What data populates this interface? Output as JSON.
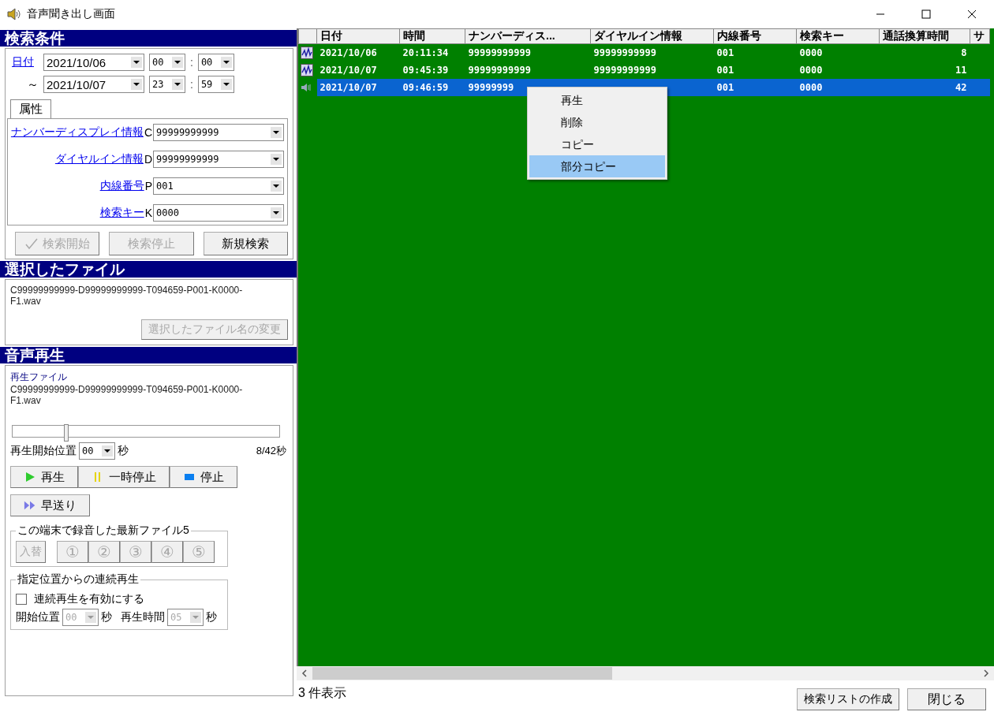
{
  "window": {
    "title": "音声聞き出し画面"
  },
  "search": {
    "title": "検索条件",
    "date_label": "日付",
    "range_mark": "～",
    "from": {
      "date": "2021/10/06",
      "hour": "00",
      "sep": ":",
      "minute": "00"
    },
    "to": {
      "date": "2021/10/07",
      "hour": "23",
      "sep": ":",
      "minute": "59"
    },
    "tabs": [
      {
        "label": "属性",
        "selected": true
      }
    ],
    "fields": [
      {
        "label": "ナンバーディスプレイ情報",
        "code": "C",
        "value": "99999999999"
      },
      {
        "label": "ダイヤルイン情報",
        "code": "D",
        "value": "99999999999"
      },
      {
        "label": "内線番号",
        "code": "P",
        "value": "001"
      },
      {
        "label": "検索キー",
        "code": "K",
        "value": "0000"
      }
    ],
    "buttons": [
      {
        "label": "検索開始",
        "kind": "check",
        "disabled": true
      },
      {
        "label": "検索停止",
        "kind": "plain",
        "disabled": true
      },
      {
        "label": "新規検索",
        "kind": "plain",
        "disabled": false
      }
    ]
  },
  "selected_file": {
    "title": "選択したファイル",
    "name": "C99999999999-D99999999999-T094659-P001-K0000-F1.wav",
    "rename_button": {
      "label": "選択したファイル名の変更",
      "disabled": true
    }
  },
  "playback": {
    "title": "音声再生",
    "file_label": "再生ファイル",
    "file_name": "C99999999999-D99999999999-T094659-P001-K0000-F1.wav",
    "level": 0.2,
    "start_label": "再生開始位置",
    "start_value": "00",
    "start_unit": "秒",
    "progress": "8/42秒",
    "buttons": [
      {
        "label": "再生",
        "kind": "play"
      },
      {
        "label": "一時停止",
        "kind": "pause"
      },
      {
        "label": "停止",
        "kind": "stop"
      }
    ],
    "forward_button": {
      "label": "早送り",
      "kind": "forward"
    },
    "recent": {
      "title": "この端末で録音した最新ファイル5",
      "swap": {
        "label": "入替",
        "disabled": true
      },
      "slots": [
        {
          "label": "①",
          "disabled": true
        },
        {
          "label": "②",
          "disabled": true
        },
        {
          "label": "③",
          "disabled": true
        },
        {
          "label": "④",
          "disabled": true
        },
        {
          "label": "⑤",
          "disabled": true
        }
      ]
    },
    "continuous": {
      "title": "指定位置からの連続再生",
      "checkbox": {
        "label": "連続再生を有効にする",
        "checked": false
      },
      "disabled": true,
      "start_label": "開始位置",
      "start_value": "00",
      "start_unit": "秒",
      "duration_label": "再生時間",
      "duration_value": "05",
      "duration_unit": "秒"
    }
  },
  "list": {
    "columns": [
      "日付",
      "時間",
      "ナンバーディス...",
      "ダイヤルイン情報",
      "内線番号",
      "検索キー",
      "通話換算時間",
      "サ"
    ],
    "rows": [
      {
        "kind": "recorded",
        "selected": false,
        "cells": [
          "2021/10/06",
          "20:11:34",
          "99999999999",
          "99999999999",
          "001",
          "0000",
          "8"
        ]
      },
      {
        "kind": "recorded",
        "selected": false,
        "cells": [
          "2021/10/07",
          "09:45:39",
          "99999999999",
          "99999999999",
          "001",
          "0000",
          "11"
        ]
      },
      {
        "kind": "speaker",
        "selected": true,
        "cells": [
          "2021/10/07",
          "09:46:59",
          "99999999",
          "",
          "001",
          "0000",
          "42"
        ]
      }
    ]
  },
  "context_menu": {
    "items": [
      {
        "label": "再生",
        "selected": false
      },
      {
        "label": "削除",
        "selected": false
      },
      {
        "label": "コピー",
        "selected": false
      },
      {
        "label": "部分コピー",
        "selected": true
      }
    ]
  },
  "status": "3 件表示",
  "footer_buttons": [
    {
      "label": "検索リストの作成"
    },
    {
      "label": "閉じる"
    }
  ]
}
